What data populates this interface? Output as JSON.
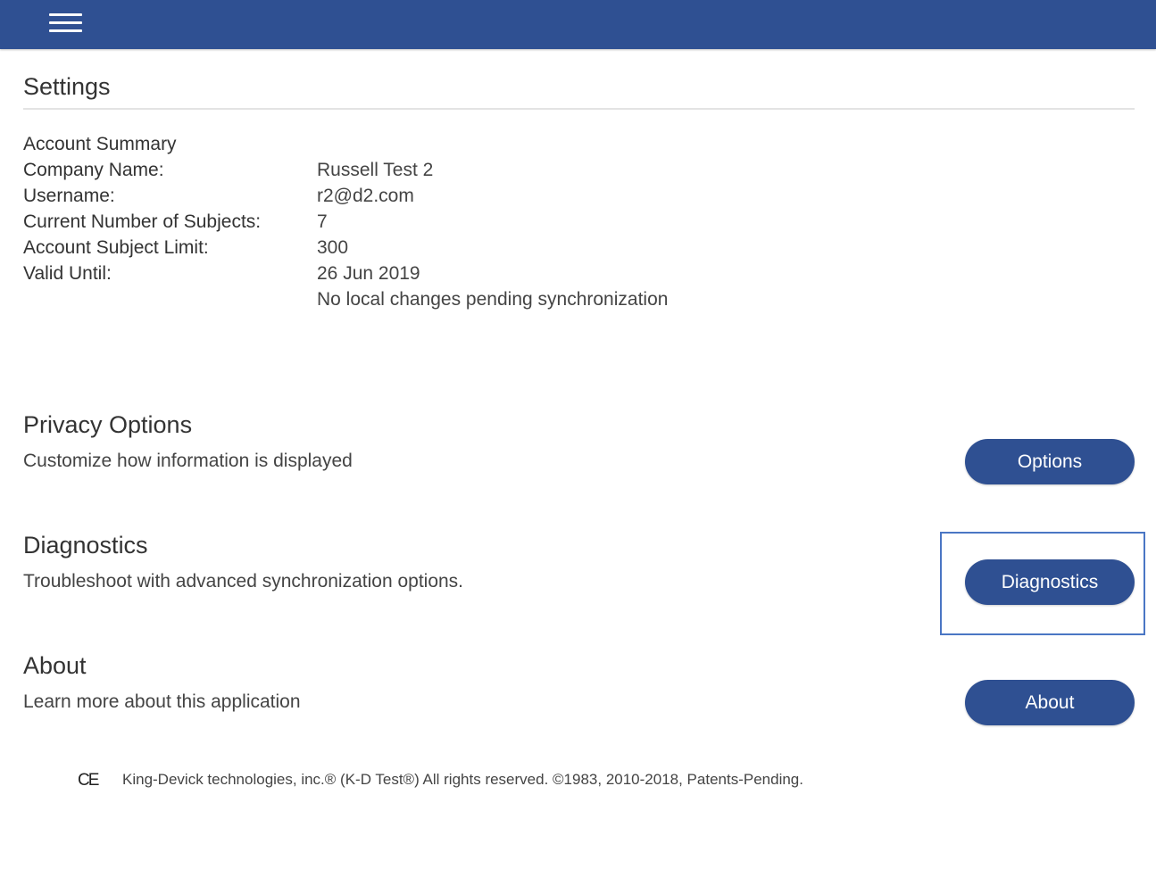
{
  "header": {
    "menu_icon": "hamburger-menu-icon",
    "background_color": "#2f5092"
  },
  "page": {
    "title": "Settings"
  },
  "account_summary": {
    "heading": "Account Summary",
    "rows": [
      {
        "label": "Company Name:",
        "value": "Russell Test 2"
      },
      {
        "label": "Username:",
        "value": "r2@d2.com"
      },
      {
        "label": "Current Number of Subjects:",
        "value": "7"
      },
      {
        "label": "Account Subject Limit:",
        "value": "300"
      },
      {
        "label": "Valid Until:",
        "value": "26 Jun 2019"
      }
    ],
    "sync_status": "No local changes pending synchronization"
  },
  "sections": {
    "privacy": {
      "title": "Privacy Options",
      "description": "Customize how information is displayed",
      "button_label": "Options"
    },
    "diagnostics": {
      "title": "Diagnostics",
      "description": "Troubleshoot with advanced synchronization options.",
      "button_label": "Diagnostics"
    },
    "about": {
      "title": "About",
      "description": "Learn more about this application",
      "button_label": "About"
    }
  },
  "footer": {
    "ce_mark": "CE",
    "copyright": "King-Devick technologies, inc.® (K-D Test®) All rights reserved. ©1983, 2010-2018, Patents-Pending."
  },
  "colors": {
    "accent": "#2f5092",
    "highlight_border": "#4a76c4"
  }
}
